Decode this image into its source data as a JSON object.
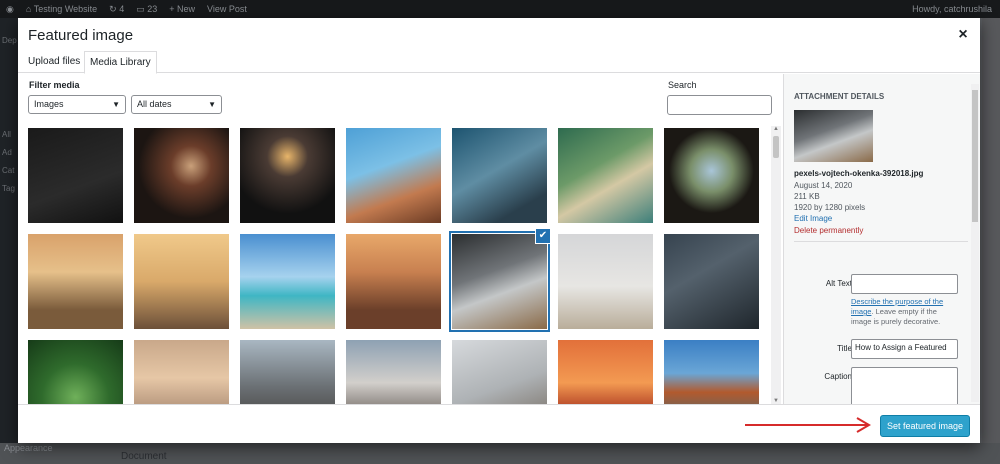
{
  "admin_bar": {
    "site_name": "Testing Website",
    "updates_count": "4",
    "comments_count": "23",
    "new_label": "New",
    "view_post_label": "View Post",
    "greeting": "Howdy, catchrushila"
  },
  "background": {
    "sidebar_fragments": [
      "Dep",
      "All",
      "Ad",
      "Cat",
      "Tag"
    ],
    "appearance_label": "Appearance",
    "document_label": "Document"
  },
  "modal": {
    "title": "Featured image",
    "close_label": "×",
    "tabs": [
      {
        "label": "Upload files",
        "active": false
      },
      {
        "label": "Media Library",
        "active": true
      }
    ],
    "filter_label": "Filter media",
    "type_filter": "Images",
    "date_filter": "All dates",
    "search_label": "Search",
    "search_value": ""
  },
  "media_grid": {
    "items": [
      {
        "name": "dark-room-person",
        "bg": "linear-gradient(160deg,#1a1a1a,#2b2b2b 60%,#111)",
        "selected": false
      },
      {
        "name": "woman-lights-bokeh",
        "bg": "radial-gradient(circle at 60% 40%,#c9a07a 0,#6b3d2a 25%,#1c1512 65%)",
        "selected": false
      },
      {
        "name": "candle-lantern",
        "bg": "radial-gradient(circle at 50% 30%,#e8b56a 0,#4a3b34 25%,#111 70%)",
        "selected": false
      },
      {
        "name": "smiling-woman-beach",
        "bg": "linear-gradient(160deg,#4ea0d6,#7cc0e6 40%,#c27a4f 70%,#6b3b24)",
        "selected": false
      },
      {
        "name": "camera-lens-blue",
        "bg": "linear-gradient(150deg,#1d5470,#5f8da3 45%,#2a3f4c 80%)",
        "selected": false
      },
      {
        "name": "coastline-aerial",
        "bg": "linear-gradient(150deg,#2e6b4f,#6c9a68 40%,#d4c8a4 60%,#3d7f7a)",
        "selected": false
      },
      {
        "name": "cave-mountain-view",
        "bg": "radial-gradient(circle at 50% 45%,#a9c5d8 0,#7a8f6a 30%,#1b1814 60%)",
        "selected": false
      },
      {
        "name": "sunset-field-girl",
        "bg": "linear-gradient(180deg,#d9a26b,#e6c08a 40%,#7a5b3b 80%)",
        "selected": false
      },
      {
        "name": "golden-field-motorbike",
        "bg": "linear-gradient(180deg,#f0c98a,#d9a96a 50%,#6c5039)",
        "selected": false
      },
      {
        "name": "resort-pool-palms",
        "bg": "linear-gradient(180deg,#4a8fd0,#a6d2ee 45%,#3fb6c4 65%,#cfc2a6)",
        "selected": false
      },
      {
        "name": "temple-sunset",
        "bg": "linear-gradient(180deg,#e8a86a,#c88050 40%,#6b3f2a 80%)",
        "selected": false
      },
      {
        "name": "hand-mouse-desk",
        "bg": "linear-gradient(160deg,#2b2e30,#707478 40%,#c4c7c8 60%,#8a6a48)",
        "selected": true
      },
      {
        "name": "woman-walking-beach",
        "bg": "linear-gradient(180deg,#d5d6d8,#e7e6e3 55%,#b9ad9a)",
        "selected": false
      },
      {
        "name": "phone-youtube",
        "bg": "linear-gradient(150deg,#36434f,#54616c 40%,#1f262c)",
        "selected": false
      },
      {
        "name": "leaves-face",
        "bg": "radial-gradient(circle at 50% 60%,#6fb05a 0,#2f6b2c 45%,#163b18)",
        "selected": false
      },
      {
        "name": "blonde-woman",
        "bg": "linear-gradient(180deg,#c9a88a,#e6c7a6 40%,#8a6a58)",
        "selected": false
      },
      {
        "name": "man-sunglasses-street",
        "bg": "linear-gradient(180deg,#a9b7c2,#6a6f73 50%,#3a3631)",
        "selected": false
      },
      {
        "name": "woman-sunglasses-city",
        "bg": "linear-gradient(180deg,#8ea1b3,#d2cfcb 45%,#3a2f2a)",
        "selected": false
      },
      {
        "name": "laptop-typing",
        "bg": "linear-gradient(160deg,#d6d9dc,#aeb2b5 50%,#6e6357)",
        "selected": false
      },
      {
        "name": "orange-sunset-sea",
        "bg": "linear-gradient(180deg,#e2703a,#f39a52 45%,#b84a2a 70%,#3a1e18)",
        "selected": false
      },
      {
        "name": "lake-mountains",
        "bg": "linear-gradient(180deg,#3b7fc4,#6aa6d6 35%,#b25a2e 55%,#1f6e8c)",
        "selected": false
      }
    ]
  },
  "attachment": {
    "heading": "Attachment Details",
    "thumb_bg": "linear-gradient(160deg,#2b2e30,#707478 40%,#c4c7c8 60%,#8a6a48)",
    "filename": "pexels-vojtech-okenka-392018.jpg",
    "date": "August 14, 2020",
    "size": "211 KB",
    "dimensions": "1920 by 1280 pixels",
    "edit_label": "Edit Image",
    "delete_label": "Delete permanently",
    "alt_label": "Alt Text",
    "alt_value": "",
    "help_link": "Describe the purpose of the image",
    "help_text": ". Leave empty if the image is purely decorative.",
    "title_label": "Title",
    "title_value": "How to Assign a Featured",
    "caption_label": "Caption",
    "caption_value": ""
  },
  "footer": {
    "primary_button": "Set featured image"
  },
  "colors": {
    "accent": "#2271b1",
    "primary_button": "#2ea2cc",
    "arrow": "#d62b2b",
    "delete": "#b32d2e"
  }
}
